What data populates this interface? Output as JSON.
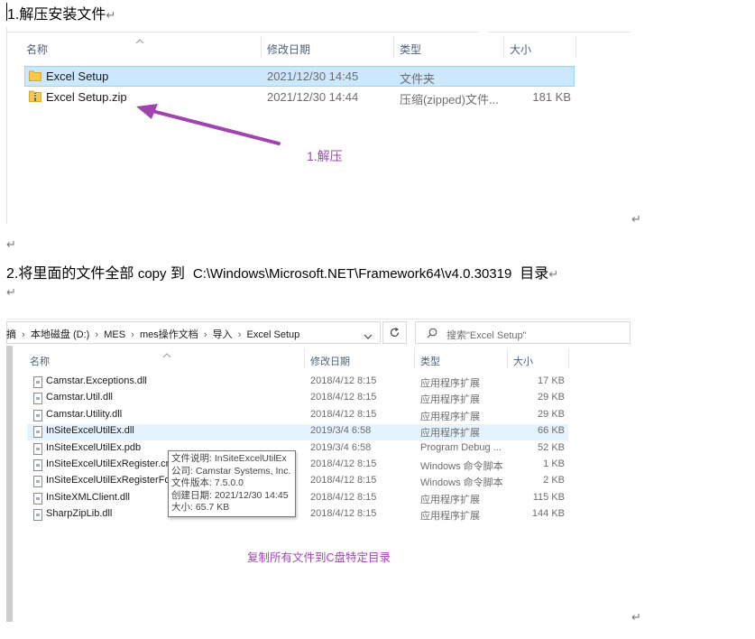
{
  "step1": {
    "heading": "1.解压安装文件",
    "para_mark": "↵"
  },
  "explorer1": {
    "columns": {
      "name": "名称",
      "modified": "修改日期",
      "type": "类型",
      "size": "大小"
    },
    "rows": [
      {
        "name": "Excel Setup",
        "modified": "2021/12/30 14:45",
        "type": "文件夹",
        "size": "",
        "selected": true,
        "icon": "folder-icon"
      },
      {
        "name": "Excel Setup.zip",
        "modified": "2021/12/30 14:44",
        "type": "压缩(zipped)文件...",
        "size": "181 KB",
        "selected": false,
        "icon": "zip-folder-icon"
      }
    ],
    "annotation": "1.解压",
    "annotation_color": "#a044b0"
  },
  "step2": {
    "heading_prefix": "2.将里面的文件全部",
    "copy_word": "copy",
    "to_word": "到",
    "path": "C:\\Windows\\Microsoft.NET\\Framework64\\v4.0.30319",
    "suffix": "目录",
    "para_mark": "↵"
  },
  "explorer2": {
    "breadcrumb": [
      "摘",
      "本地磁盘 (D:)",
      "MES",
      "mes操作文档",
      "导入",
      "Excel Setup"
    ],
    "search_placeholder": "搜索\"Excel Setup\"",
    "columns": {
      "name": "名称",
      "modified": "修改日期",
      "type": "类型",
      "size": "大小"
    },
    "rows": [
      {
        "name": "Camstar.Exceptions.dll",
        "modified": "2018/4/12 8:15",
        "type": "应用程序扩展",
        "size": "17 KB"
      },
      {
        "name": "Camstar.Util.dll",
        "modified": "2018/4/12 8:15",
        "type": "应用程序扩展",
        "size": "29 KB"
      },
      {
        "name": "Camstar.Utility.dll",
        "modified": "2018/4/12 8:15",
        "type": "应用程序扩展",
        "size": "29 KB"
      },
      {
        "name": "InSiteExcelUtilEx.dll",
        "modified": "2019/3/4 6:58",
        "type": "应用程序扩展",
        "size": "66 KB",
        "hover": true
      },
      {
        "name": "InSiteExcelUtilEx.pdb",
        "modified": "2019/3/4 6:58",
        "type": "Program Debug ...",
        "size": "52 KB"
      },
      {
        "name": "InSiteExcelUtilExRegister.cr",
        "modified": "2018/4/12 8:15",
        "type": "Windows 命令脚本",
        "size": "1 KB"
      },
      {
        "name": "InSiteExcelUtilExRegisterFo",
        "modified": "2018/4/12 8:15",
        "type": "Windows 命令脚本",
        "size": "2 KB"
      },
      {
        "name": "InSiteXMLClient.dll",
        "modified": "2018/4/12 8:15",
        "type": "应用程序扩展",
        "size": "115 KB"
      },
      {
        "name": "SharpZipLib.dll",
        "modified": "2018/4/12 8:15",
        "type": "应用程序扩展",
        "size": "144 KB"
      }
    ],
    "tooltip": {
      "description": "文件说明: InSiteExcelUtilEx",
      "company": "公司: Camstar Systems, Inc.",
      "version": "文件版本: 7.5.0.0",
      "created": "创建日期: 2021/12/30 14:45",
      "size": "大小: 65.7 KB"
    },
    "annotation": "复制所有文件到C盘特定目录"
  }
}
